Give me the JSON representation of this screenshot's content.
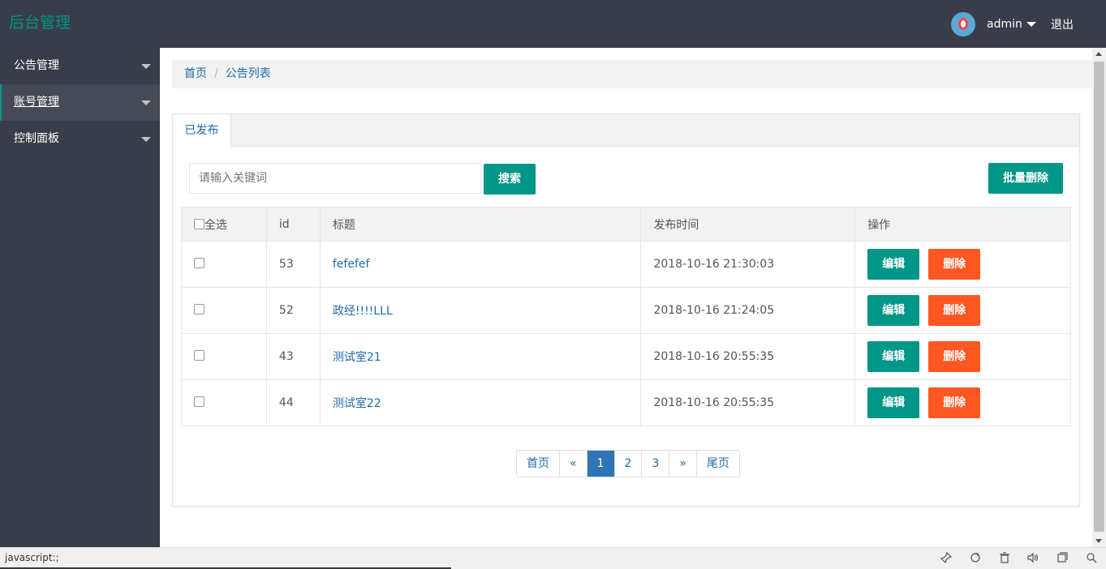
{
  "header": {
    "logo": "后台管理",
    "username": "admin",
    "logout": "退出"
  },
  "sidebar": {
    "items": [
      {
        "label": "公告管理"
      },
      {
        "label": "账号管理"
      },
      {
        "label": "控制面板"
      }
    ]
  },
  "breadcrumb": {
    "home": "首页",
    "separator": "/",
    "current": "公告列表"
  },
  "tabs": {
    "published": "已发布"
  },
  "search": {
    "placeholder": "请输入关键词",
    "button": "搜索"
  },
  "batch_delete": "批量删除",
  "table": {
    "headers": {
      "select_all": "全选",
      "id": "id",
      "title": "标题",
      "time": "发布时间",
      "actions": "操作"
    },
    "rows": [
      {
        "id": "53",
        "title": "fefefef",
        "time": "2018-10-16 21:30:03"
      },
      {
        "id": "52",
        "title": "政经!!!!LLL",
        "time": "2018-10-16 21:24:05"
      },
      {
        "id": "43",
        "title": "测试室21",
        "time": "2018-10-16 20:55:35"
      },
      {
        "id": "44",
        "title": "测试室22",
        "time": "2018-10-16 20:55:35"
      }
    ],
    "edit_label": "编辑",
    "delete_label": "删除"
  },
  "pagination": {
    "first": "首页",
    "prev": "«",
    "pages": [
      "1",
      "2",
      "3"
    ],
    "next": "»",
    "last": "尾页"
  },
  "statusbar": {
    "text": "javascript:;"
  },
  "colors": {
    "brand": "#009688",
    "danger": "#ff5722",
    "header_bg": "#393d49",
    "link": "#1e6aa7",
    "page_active": "#2f75b5"
  }
}
